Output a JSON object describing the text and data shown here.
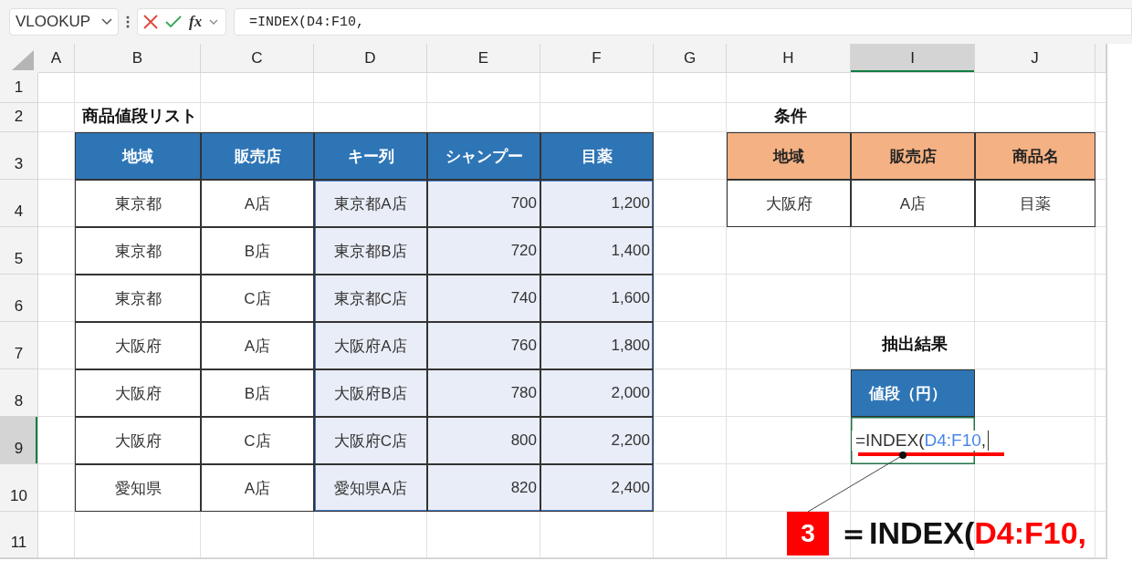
{
  "formula_bar": {
    "name_box": "VLOOKUP",
    "function_label": "fx",
    "formula": "=INDEX(D4:F10,"
  },
  "column_headers": [
    {
      "label": "A",
      "selected": false
    },
    {
      "label": "B",
      "selected": false
    },
    {
      "label": "C",
      "selected": false
    },
    {
      "label": "D",
      "selected": false
    },
    {
      "label": "E",
      "selected": false
    },
    {
      "label": "F",
      "selected": false
    },
    {
      "label": "G",
      "selected": false
    },
    {
      "label": "H",
      "selected": false
    },
    {
      "label": "I",
      "selected": true
    },
    {
      "label": "J",
      "selected": false
    }
  ],
  "row_headers": [
    {
      "label": "1",
      "selected": false
    },
    {
      "label": "2",
      "selected": false
    },
    {
      "label": "3",
      "selected": false
    },
    {
      "label": "4",
      "selected": false
    },
    {
      "label": "5",
      "selected": false
    },
    {
      "label": "6",
      "selected": false
    },
    {
      "label": "7",
      "selected": false
    },
    {
      "label": "8",
      "selected": false
    },
    {
      "label": "9",
      "selected": true
    },
    {
      "label": "10",
      "selected": false
    },
    {
      "label": "11",
      "selected": false
    }
  ],
  "price_list": {
    "title": "商品値段リスト",
    "columns": [
      {
        "label": "地域",
        "highlighted": false
      },
      {
        "label": "販売店",
        "highlighted": false
      },
      {
        "label": "キー列",
        "highlighted": true
      },
      {
        "label": "シャンプー",
        "highlighted": true
      },
      {
        "label": "目薬",
        "highlighted": true
      }
    ],
    "rows": [
      [
        "東京都",
        "A店",
        "東京都A店",
        "700",
        "1,200"
      ],
      [
        "東京都",
        "B店",
        "東京都B店",
        "720",
        "1,400"
      ],
      [
        "東京都",
        "C店",
        "東京都C店",
        "740",
        "1,600"
      ],
      [
        "大阪府",
        "A店",
        "大阪府A店",
        "760",
        "1,800"
      ],
      [
        "大阪府",
        "B店",
        "大阪府B店",
        "780",
        "2,000"
      ],
      [
        "大阪府",
        "C店",
        "大阪府C店",
        "800",
        "2,200"
      ],
      [
        "愛知県",
        "A店",
        "愛知県A店",
        "820",
        "2,400"
      ]
    ]
  },
  "conditions": {
    "title": "条件",
    "columns": [
      "地域",
      "販売店",
      "商品名"
    ],
    "values": [
      "大阪府",
      "A店",
      "目薬"
    ]
  },
  "result": {
    "title": "抽出結果",
    "header": "値段（円）",
    "editing_formula": {
      "prefix": "=INDEX(",
      "reference": "D4:F10",
      "suffix": ","
    }
  },
  "annotation": {
    "step": "3",
    "prefix": "＝INDEX(",
    "reference": "D4:F10,"
  }
}
